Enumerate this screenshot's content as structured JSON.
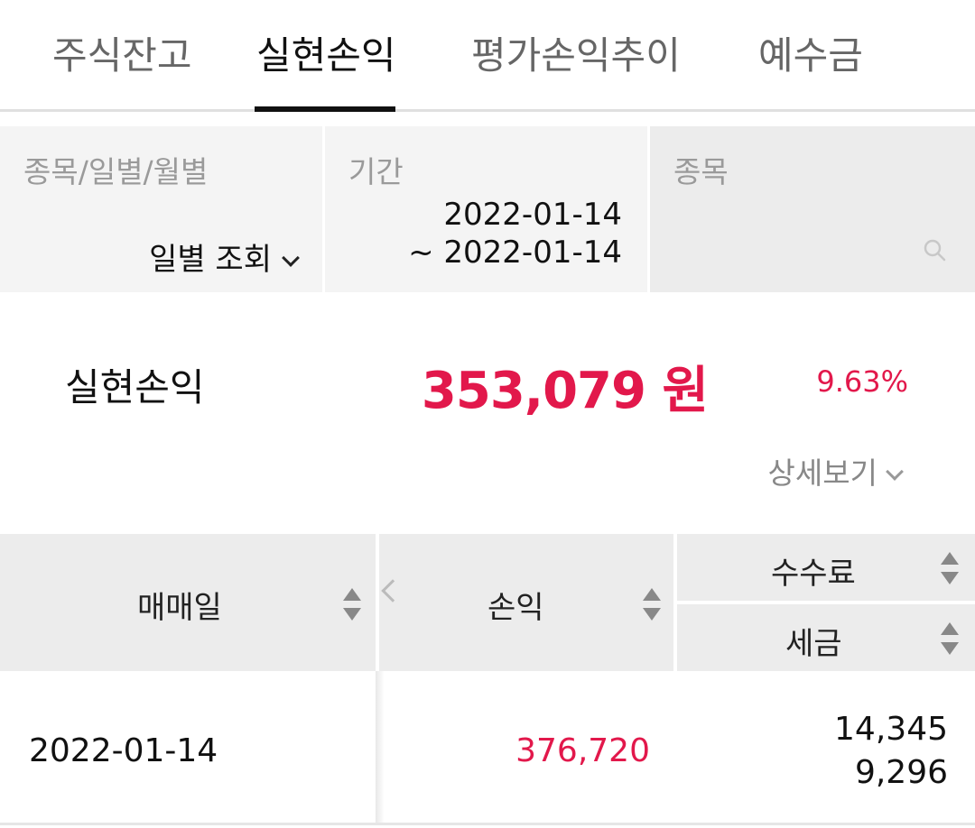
{
  "tabs": [
    "주식잔고",
    "실현손익",
    "평가손익추이",
    "예수금"
  ],
  "active_tab": "실현손익",
  "filters": {
    "type_label": "종목/일별/월별",
    "type_value": "일별 조회",
    "period_label": "기간",
    "period_start": "2022-01-14",
    "period_end": "~ 2022-01-14",
    "stock_label": "종목"
  },
  "summary": {
    "label": "실현손익",
    "amount": "353,079 원",
    "percent": "9.63%",
    "detail_button": "상세보기"
  },
  "table": {
    "headers": {
      "date": "매매일",
      "profit_loss": "손익",
      "fee": "수수료",
      "tax": "세금"
    },
    "rows": [
      {
        "date": "2022-01-14",
        "profit_loss": "376,720",
        "fee": "14,345",
        "tax": "9,296"
      }
    ]
  },
  "colors": {
    "accent_red": "#e2184b",
    "header_bg": "#ececec",
    "filter_bg": "#f4f4f4"
  },
  "icons": [
    "chevron-down-icon",
    "search-icon",
    "sort-icon",
    "chevron-left-icon"
  ]
}
